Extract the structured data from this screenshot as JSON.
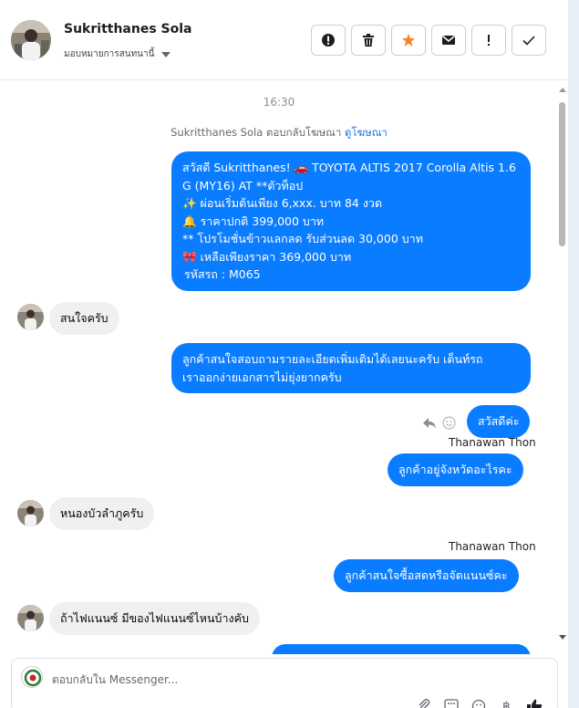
{
  "header": {
    "contact_name": "Sukritthanes Sola",
    "assign_label": "มอบหมายการสนทนานี้",
    "actions": [
      {
        "name": "spam",
        "icon": "exclamation-circle-icon"
      },
      {
        "name": "delete",
        "icon": "trash-icon"
      },
      {
        "name": "star",
        "icon": "star-icon"
      },
      {
        "name": "unread",
        "icon": "envelope-icon"
      },
      {
        "name": "important",
        "icon": "exclamation-icon"
      },
      {
        "name": "done",
        "icon": "check-icon"
      }
    ]
  },
  "colors": {
    "accent": "#0a7cff",
    "star": "#f5852a",
    "incoming_bubble": "#f0f0f0"
  },
  "conversation": {
    "time": "16:30",
    "reply_note_prefix": "Sukritthanes Sola ตอบกลับโฆษณา",
    "reply_note_link": "ดูโฆษณา",
    "ad_message": [
      "สวัสดี Sukritthanes! 🚗 TOYOTA ALTIS 2017 Corolla Altis 1.6",
      "G (MY16) AT **ตัวท็อป",
      "✨ ผ่อนเริ่มต้นเพียง 6,xxx. บาท 84 งวด",
      "🔔 ราคาปกติ 399,000 บาท",
      "** โปรโมชั่นข้าวแลกลด รับส่วนลด 30,000 บาท",
      "🎀 เหลือเพียงราคา 369,000 บาท",
      "รหัสรถ : M065"
    ],
    "msg_in_1": "สนใจครับ",
    "msg_out_1_lines": [
      "ลูกค้าสนใจสอบถามรายละเอียดเพิ่มเติมได้เลยนะครับ เต็นท์รถ",
      "เราออกง่ายเอกสารไม่ยุ่งยากครับ"
    ],
    "msg_out_2": "สวัสดีค่ะ",
    "sender_1": "Thanawan Thon",
    "msg_out_3": "ลูกค้าอยู่จังหวัดอะไรคะ",
    "msg_in_2": "หนองบัวลำภูครับ",
    "sender_2": "Thanawan Thon",
    "msg_out_4": "ลูกค้าสนใจซื้อสดหรือจัดแนนซ์คะ",
    "msg_in_3": "ถ้าไฟแนนซ์ มีของไฟแนนซ์ไหนบ้างคับ"
  },
  "composer": {
    "placeholder": "ตอบกลับใน Messenger...",
    "tools": [
      "paperclip-icon",
      "grid-icon",
      "emoji-icon",
      "baht-icon",
      "thumbs-up-icon"
    ]
  }
}
